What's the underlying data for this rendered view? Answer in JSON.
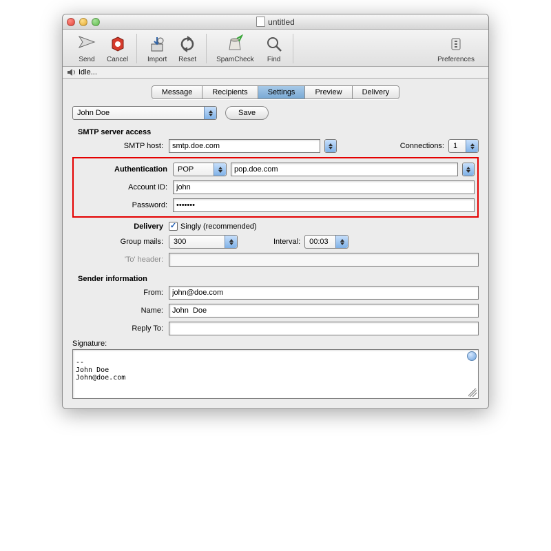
{
  "window": {
    "title": "untitled"
  },
  "toolbar": {
    "send": "Send",
    "cancel": "Cancel",
    "import": "Import",
    "reset": "Reset",
    "spamcheck": "SpamCheck",
    "find": "Find",
    "preferences": "Preferences"
  },
  "status": {
    "text": "Idle..."
  },
  "tabs": {
    "items": [
      "Message",
      "Recipients",
      "Settings",
      "Preview",
      "Delivery"
    ],
    "active_index": 2
  },
  "profile": {
    "selected": "John Doe",
    "save_label": "Save"
  },
  "smtp": {
    "section": "SMTP server access",
    "host_label": "SMTP host:",
    "host_value": "smtp.doe.com",
    "connections_label": "Connections:",
    "connections_value": "1"
  },
  "auth": {
    "section": "Authentication",
    "scheme": "POP",
    "server": "pop.doe.com",
    "account_label": "Account ID:",
    "account_value": "john",
    "password_label": "Password:",
    "password_value": "•••••••"
  },
  "delivery": {
    "section": "Delivery",
    "singly_label": "Singly (recommended)",
    "singly_checked": true,
    "group_label": "Group mails:",
    "group_value": "300",
    "interval_label": "Interval:",
    "interval_value": "00:03",
    "to_header_label": "'To' header:",
    "to_header_value": ""
  },
  "sender": {
    "section": "Sender information",
    "from_label": "From:",
    "from_value": "john@doe.com",
    "name_label": "Name:",
    "name_value": "John  Doe",
    "reply_label": "Reply To:",
    "reply_value": ""
  },
  "signature": {
    "label": "Signature:",
    "value": "--\nJohn Doe\nJohn@doe.com"
  }
}
